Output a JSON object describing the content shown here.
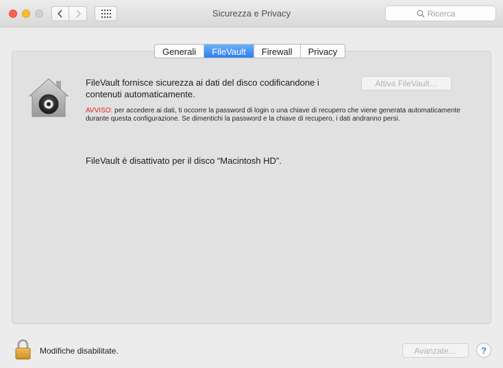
{
  "window": {
    "title": "Sicurezza e Privacy",
    "search_placeholder": "Ricerca"
  },
  "tabs": [
    {
      "label": "Generali",
      "active": false
    },
    {
      "label": "FileVault",
      "active": true
    },
    {
      "label": "Firewall",
      "active": false
    },
    {
      "label": "Privacy",
      "active": false
    }
  ],
  "filevault": {
    "description": "FileVault fornisce sicurezza ai dati del disco codificandone i contenuti automaticamente.",
    "activate_button": "Attiva FileVault…",
    "warning_label": "AVVISO:",
    "warning_text": " per accedere ai dati, ti occorre la password di login o una chiave di recupero che viene generata automaticamente durante questa configurazione. Se dimentichi la password e la chiave di recupero, i dati andranno persi.",
    "status": "FileVault è disattivato per il disco “Macintosh HD”."
  },
  "footer": {
    "lock_label": "Modifiche disabilitate.",
    "advanced_button": "Avanzate…",
    "help_label": "?"
  },
  "colors": {
    "accent": "#2b7df5",
    "warning": "#e2211c"
  },
  "icons": {
    "house": "filevault-house-icon",
    "lock": "padlock-icon",
    "search": "magnifier-icon"
  }
}
